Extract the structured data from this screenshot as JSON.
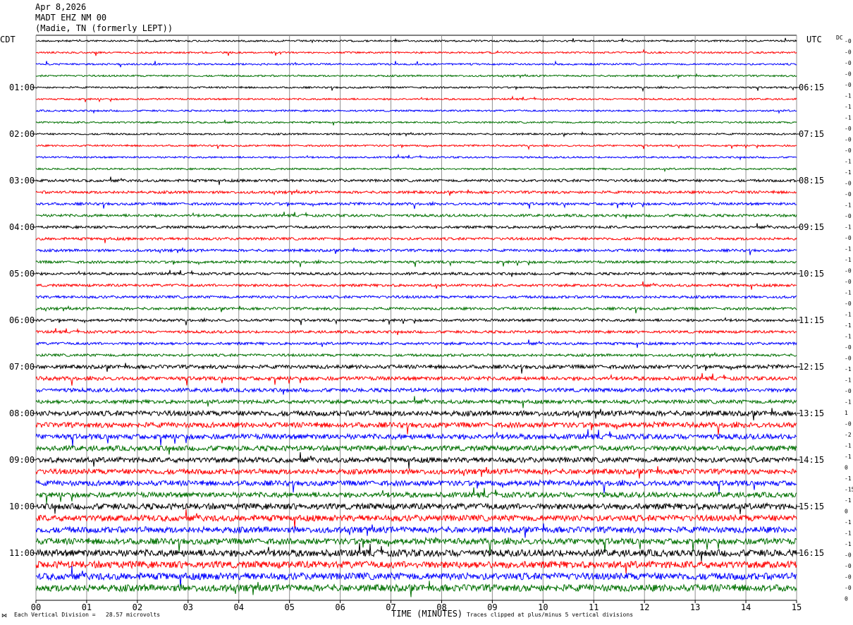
{
  "header": {
    "date": "Apr 8,2026",
    "station": "MADT EHZ NM 00",
    "location": "(Madie, TN (formerly LEPT))"
  },
  "left_label": "CDT",
  "right_label": "UTC",
  "dc_label": "DC",
  "footer": {
    "scale_note": "Each Vertical Division =   28.57 microvolts",
    "corner_mark": "⋈",
    "xlabel": "TIME (MINUTES)",
    "clip_note": "Traces clipped at plus/minus 5 vertical divisions"
  },
  "chart_data": {
    "type": "line",
    "title": "",
    "xlabel": "TIME (MINUTES)",
    "xlim": [
      0,
      15
    ],
    "x_ticks": [
      "00",
      "01",
      "02",
      "03",
      "04",
      "05",
      "06",
      "07",
      "08",
      "09",
      "10",
      "11",
      "12",
      "13",
      "14",
      "15"
    ],
    "rows": 48,
    "trace_colors": [
      "#000000",
      "#ff0000",
      "#0000ff",
      "#007000"
    ],
    "cdt_hour_labels": [
      "01:00",
      "02:00",
      "03:00",
      "04:00",
      "05:00",
      "06:00",
      "07:00",
      "08:00",
      "09:00",
      "10:00",
      "11:00"
    ],
    "utc_hour_labels": [
      "06:15",
      "07:15",
      "08:15",
      "09:15",
      "10:15",
      "11:15",
      "12:15",
      "13:15",
      "14:15",
      "15:15",
      "16:15"
    ],
    "dc_offsets": [
      "-0",
      "-0",
      "-0",
      "-0",
      "-0",
      "-1",
      "-1",
      "-1",
      "-0",
      "-0",
      "-0",
      "-1",
      "-1",
      "-0",
      "-0",
      "-1",
      "-0",
      "-1",
      "-0",
      "-1",
      "-1",
      "-0",
      "-0",
      "-1",
      "-0",
      "-1",
      "-1",
      "-1",
      "-0",
      "-0",
      "-1",
      "-1",
      "-0",
      "-1",
      "1",
      "-0",
      "-2",
      "-1",
      "-1",
      "0",
      "-1",
      "-15",
      "-1",
      "0",
      "-1",
      "-1",
      "-1",
      "-0",
      "-0",
      "-0",
      "-0",
      "0"
    ]
  }
}
